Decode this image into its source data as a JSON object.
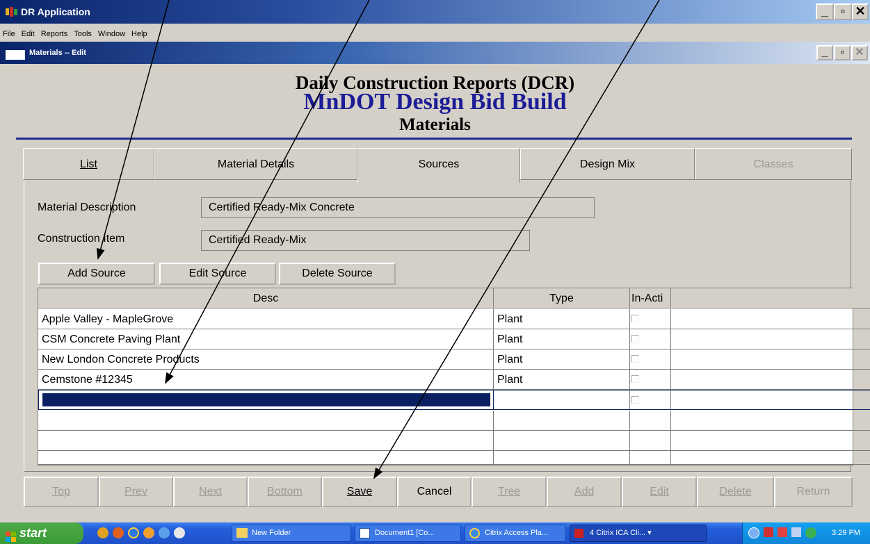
{
  "app_title": "DR Application",
  "menu": [
    "File",
    "Edit",
    "Reports",
    "Tools",
    "Window",
    "Help"
  ],
  "child_title": "Materials -- Edit",
  "header": {
    "line1": "Daily Construction Reports (DCR)",
    "line2": "MnDOT Design Bid Build",
    "line3": "Materials"
  },
  "tabs": [
    {
      "label": "List",
      "state": "normal"
    },
    {
      "label": "Material Details",
      "state": "normal"
    },
    {
      "label": "Sources",
      "state": "active"
    },
    {
      "label": "Design Mix",
      "state": "normal"
    },
    {
      "label": "Classes",
      "state": "disabled"
    }
  ],
  "form": {
    "material_description_label": "Material Description",
    "material_description_value": "Certified Ready-Mix Concrete",
    "construction_item_label": "Construction Item",
    "construction_item_value": "Certified Ready-Mix"
  },
  "source_buttons": {
    "add": "Add  Source",
    "edit": "Edit Source",
    "delete": "Delete Source"
  },
  "grid": {
    "columns": [
      "Desc",
      "Type",
      "In-Acti",
      ""
    ],
    "rows": [
      {
        "desc": "Apple Valley - MapleGrove",
        "type": "Plant"
      },
      {
        "desc": "CSM Concrete Paving Plant",
        "type": "Plant"
      },
      {
        "desc": "New London Concrete Products",
        "type": "Plant"
      },
      {
        "desc": "Cemstone #12345",
        "type": "Plant"
      },
      {
        "desc": "",
        "type": ""
      }
    ]
  },
  "nav_buttons": [
    {
      "label": "Top",
      "enabled": false
    },
    {
      "label": "Prev",
      "enabled": false
    },
    {
      "label": "Next",
      "enabled": false
    },
    {
      "label": "Bottom",
      "enabled": false
    },
    {
      "label": "Save",
      "enabled": true
    },
    {
      "label": "Cancel",
      "enabled": true
    },
    {
      "label": "Tree",
      "enabled": false
    },
    {
      "label": "Add",
      "enabled": false
    },
    {
      "label": "Edit",
      "enabled": false
    },
    {
      "label": "Delete",
      "enabled": false
    },
    {
      "label": "Return",
      "enabled": false
    }
  ],
  "taskbar": {
    "start": "start",
    "items": [
      "New Folder",
      "Document1 [Co...",
      "Citrix Access Pla...",
      "4 Citrix ICA Cli..."
    ],
    "clock": "3:29 PM"
  },
  "colors": {
    "title_blue": "#0a246a",
    "header_blue": "#1c1c96",
    "selection": "#0a2060",
    "face": "#d4d0c8"
  }
}
